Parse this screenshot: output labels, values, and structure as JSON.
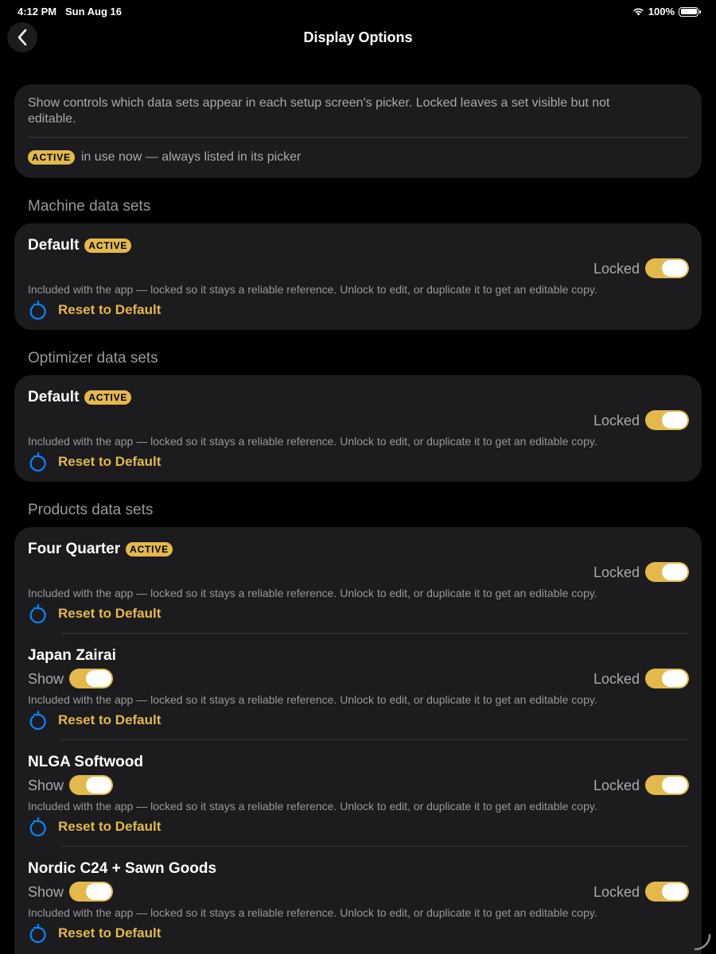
{
  "status": {
    "time": "4:12 PM",
    "date": "Sun Aug 16",
    "battery": "100%"
  },
  "nav": {
    "title": "Display Options"
  },
  "info": {
    "text": "Show controls which data sets appear in each setup screen's picker. Locked leaves a set visible but not editable.",
    "badge": "ACTIVE",
    "legend": "in use now — always listed in its picker"
  },
  "sections": {
    "machine": {
      "header": "Machine data sets",
      "items": [
        {
          "name": "Default",
          "badge": "ACTIVE",
          "locked_label": "Locked",
          "locked": true,
          "description": "Included with the app — locked so it stays a reliable reference. Unlock to edit, or duplicate it to get an editable copy.",
          "reset_label": "Reset to Default"
        }
      ]
    },
    "optimizer": {
      "header": "Optimizer data sets",
      "items": [
        {
          "name": "Default",
          "badge": "ACTIVE",
          "locked_label": "Locked",
          "locked": true,
          "description": "Included with the app — locked so it stays a reliable reference. Unlock to edit, or duplicate it to get an editable copy.",
          "reset_label": "Reset to Default"
        }
      ]
    },
    "products": {
      "header": "Products data sets",
      "items": [
        {
          "name": "Four Quarter",
          "badge": "ACTIVE",
          "locked_label": "Locked",
          "locked": true,
          "description": "Included with the app — locked so it stays a reliable reference. Unlock to edit, or duplicate it to get an editable copy.",
          "reset_label": "Reset to Default"
        },
        {
          "name": "Japan Zairai",
          "show_label": "Show",
          "show": true,
          "locked_label": "Locked",
          "locked": true,
          "description": "Included with the app — locked so it stays a reliable reference. Unlock to edit, or duplicate it to get an editable copy.",
          "reset_label": "Reset to Default"
        },
        {
          "name": "NLGA Softwood",
          "show_label": "Show",
          "show": true,
          "locked_label": "Locked",
          "locked": true,
          "description": "Included with the app — locked so it stays a reliable reference. Unlock to edit, or duplicate it to get an editable copy.",
          "reset_label": "Reset to Default"
        },
        {
          "name": "Nordic C24 + Sawn Goods",
          "show_label": "Show",
          "show": true,
          "locked_label": "Locked",
          "locked": true,
          "description": "Included with the app — locked so it stays a reliable reference. Unlock to edit, or duplicate it to get an editable copy.",
          "reset_label": "Reset to Default"
        }
      ]
    }
  },
  "colors": {
    "accent": "#e3b94b",
    "icon_blue": "#0a84ff",
    "card": "#1c1c1e"
  }
}
